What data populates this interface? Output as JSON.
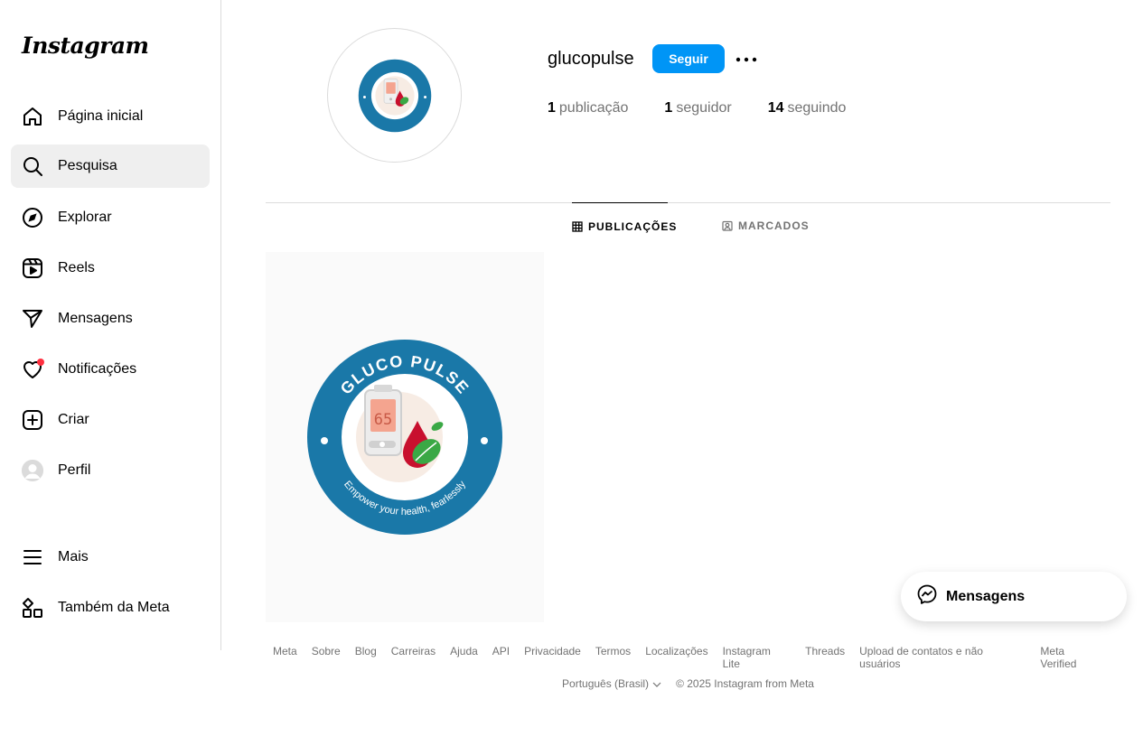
{
  "sidebar": {
    "logo": "Instagram",
    "items": [
      {
        "label": "Página inicial",
        "icon": "home-icon"
      },
      {
        "label": "Pesquisa",
        "icon": "search-icon"
      },
      {
        "label": "Explorar",
        "icon": "compass-icon"
      },
      {
        "label": "Reels",
        "icon": "reels-icon"
      },
      {
        "label": "Mensagens",
        "icon": "send-icon"
      },
      {
        "label": "Notificações",
        "icon": "heart-icon"
      },
      {
        "label": "Criar",
        "icon": "plus-square-icon"
      },
      {
        "label": "Perfil",
        "icon": "avatar"
      }
    ],
    "bottom_items": [
      {
        "label": "Mais",
        "icon": "menu-icon"
      },
      {
        "label": "Também da Meta",
        "icon": "meta-apps-icon"
      }
    ],
    "active_item": "Pesquisa"
  },
  "profile": {
    "username": "glucopulse",
    "follow_label": "Seguir",
    "stats": {
      "posts_count": "1",
      "posts_label": "publicação",
      "followers_count": "1",
      "followers_label": "seguidor",
      "following_count": "14",
      "following_label": "seguindo"
    },
    "logo_text_top": "GLUCO PULSE",
    "logo_text_bottom": "Empower your health, fearlessly",
    "logo_meter_reading": "65"
  },
  "tabs": [
    {
      "label": "PUBLICAÇÕES",
      "active": true
    },
    {
      "label": "MARCADOS",
      "active": false
    }
  ],
  "messages_widget": {
    "label": "Mensagens"
  },
  "footer": {
    "links": [
      "Meta",
      "Sobre",
      "Blog",
      "Carreiras",
      "Ajuda",
      "API",
      "Privacidade",
      "Termos",
      "Localizações",
      "Instagram Lite",
      "Threads",
      "Upload de contatos e não usuários",
      "Meta Verified"
    ],
    "language": "Português (Brasil)",
    "copyright": "© 2025 Instagram from Meta"
  },
  "colors": {
    "accent": "#0095f6",
    "logo_blue": "#1a78a8",
    "notification": "#ff3040"
  }
}
